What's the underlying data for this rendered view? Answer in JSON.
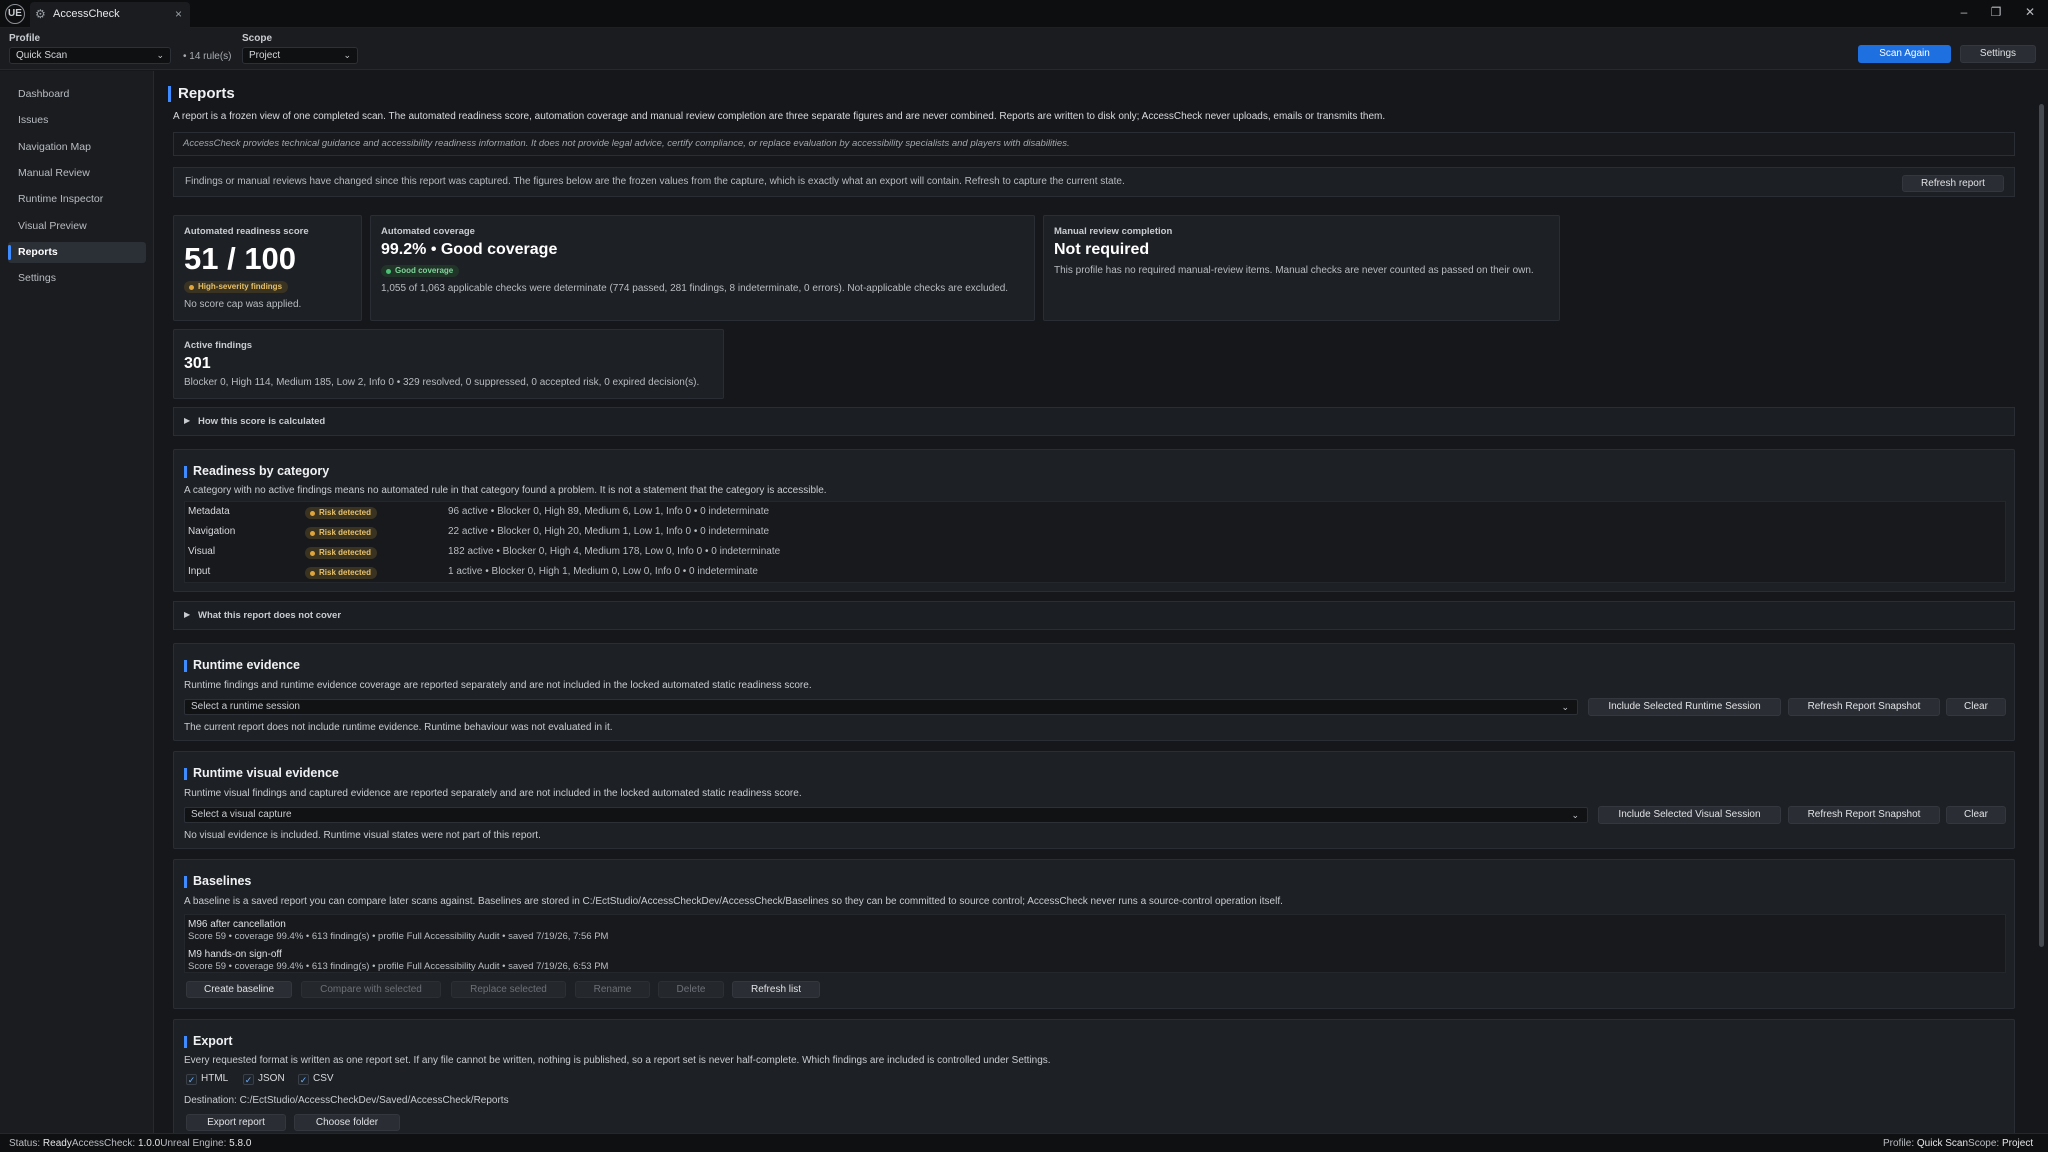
{
  "titlebar": {
    "logo": "UE",
    "tab_title": "AccessCheck",
    "tab_icon": "plugin-icon",
    "close": "×",
    "minimize": "–",
    "restore": "❐",
    "window_close": "✕"
  },
  "toolbar": {
    "profile_label": "Profile",
    "profile_value": "Quick Scan",
    "rule_count": "• 14 rule(s)",
    "scope_label": "Scope",
    "scope_value": "Project",
    "scan_again": "Scan Again",
    "settings": "Settings"
  },
  "sidebar": {
    "items": [
      {
        "label": "Dashboard"
      },
      {
        "label": "Issues"
      },
      {
        "label": "Navigation Map"
      },
      {
        "label": "Manual Review"
      },
      {
        "label": "Runtime Inspector"
      },
      {
        "label": "Visual Preview"
      },
      {
        "label": "Reports"
      },
      {
        "label": "Settings"
      }
    ],
    "active": "Reports"
  },
  "page": {
    "title": "Reports",
    "lead": "A report is a frozen view of one completed scan. The automated readiness score, automation coverage and manual review completion are three separate figures and are never combined. Reports are written to disk only; AccessCheck never uploads, emails or transmits them.",
    "disclaimer": "AccessCheck provides technical guidance and accessibility readiness information. It does not provide legal advice, certify compliance, or replace evaluation by accessibility specialists and players with disabilities.",
    "stale_banner": "Findings or manual reviews have changed since this report was captured. The figures below are the frozen values from the capture, which is exactly what an export will contain. Refresh to capture the current state.",
    "refresh_report": "Refresh report"
  },
  "cards": {
    "score": {
      "title": "Automated readiness score",
      "value": "51 / 100",
      "badge": "High-severity findings",
      "note": "No score cap was applied."
    },
    "coverage": {
      "title": "Automated coverage",
      "value": "99.2%  •  Good coverage",
      "badge": "Good coverage",
      "note": "1,055 of 1,063 applicable checks were determinate (774 passed, 281 findings, 8 indeterminate, 0 errors). Not-applicable checks are excluded."
    },
    "manual": {
      "title": "Manual review completion",
      "value": "Not required",
      "note": "This profile has no required manual-review items. Manual checks are never counted as passed on their own."
    },
    "findings": {
      "title": "Active findings",
      "value": "301",
      "note": "Blocker 0, High 114, Medium 185, Low 2, Info 0  •  329 resolved, 0 suppressed, 0 accepted risk, 0 expired decision(s)."
    }
  },
  "how_calculated": "How this score is calculated",
  "readiness": {
    "title": "Readiness by category",
    "desc": "A category with no active findings means no automated rule in that category found a problem. It is not a statement that the category is accessible.",
    "rows": [
      {
        "name": "Metadata",
        "badge": "Risk detected",
        "detail": "96 active  •  Blocker 0, High 89, Medium 6, Low 1, Info 0  •  0 indeterminate"
      },
      {
        "name": "Navigation",
        "badge": "Risk detected",
        "detail": "22 active  •  Blocker 0, High 20, Medium 1, Low 1, Info 0  •  0 indeterminate"
      },
      {
        "name": "Visual",
        "badge": "Risk detected",
        "detail": "182 active  •  Blocker 0, High 4, Medium 178, Low 0, Info 0  •  0 indeterminate"
      },
      {
        "name": "Input",
        "badge": "Risk detected",
        "detail": "1 active  •  Blocker 0, High 1, Medium 0, Low 0, Info 0  •  0 indeterminate"
      }
    ]
  },
  "not_cover": "What this report does not cover",
  "runtime": {
    "title": "Runtime evidence",
    "desc": "Runtime findings and runtime evidence coverage are reported separately and are not included in the locked automated static readiness score.",
    "select": "Select a runtime session",
    "include": "Include Selected Runtime Session",
    "refresh": "Refresh Report Snapshot",
    "clear": "Clear",
    "note": "The current report does not include runtime evidence. Runtime behaviour was not evaluated in it."
  },
  "visual": {
    "title": "Runtime visual evidence",
    "desc": "Runtime visual findings and captured evidence are reported separately and are not included in the locked automated static readiness score.",
    "select": "Select a visual capture",
    "include": "Include Selected Visual Session",
    "refresh": "Refresh Report Snapshot",
    "clear": "Clear",
    "note": "No visual evidence is included. Runtime visual states were not part of this report."
  },
  "baselines": {
    "title": "Baselines",
    "desc": "A baseline is a saved report you can compare later scans against. Baselines are stored in C:/EctStudio/AccessCheckDev/AccessCheck/Baselines so they can be committed to source control; AccessCheck never runs a source-control operation itself.",
    "items": [
      {
        "name": "M96 after cancellation",
        "meta": "Score 59  •  coverage 99.4%  •  613 finding(s)  •  profile Full Accessibility Audit  •  saved 7/19/26, 7:56 PM"
      },
      {
        "name": "M9 hands-on sign-off",
        "meta": "Score 59  •  coverage 99.4%  •  613 finding(s)  •  profile Full Accessibility Audit  •  saved 7/19/26, 6:53 PM"
      }
    ],
    "create": "Create baseline",
    "compare": "Compare with selected",
    "replace": "Replace selected",
    "rename": "Rename",
    "delete": "Delete",
    "refresh": "Refresh list"
  },
  "export": {
    "title": "Export",
    "desc": "Every requested format is written as one report set. If any file cannot be written, nothing is published, so a report set is never half-complete. Which findings are included is controlled under Settings.",
    "formats": [
      {
        "label": "HTML",
        "checked": true
      },
      {
        "label": "JSON",
        "checked": true
      },
      {
        "label": "CSV",
        "checked": true
      }
    ],
    "check_mark": "✓",
    "destination": "Destination: C:/EctStudio/AccessCheckDev/Saved/AccessCheck/Reports",
    "export_btn": "Export report",
    "choose_btn": "Choose folder"
  },
  "status": {
    "status_label": "Status:",
    "status_value": "Ready",
    "ac_label": "AccessCheck:",
    "ac_value": "1.0.0",
    "ue_label": "Unreal Engine:",
    "ue_value": "5.8.0",
    "profile_label": "Profile:",
    "profile_value": "Quick Scan",
    "scope_label": "Scope:",
    "scope_value": "Project"
  }
}
